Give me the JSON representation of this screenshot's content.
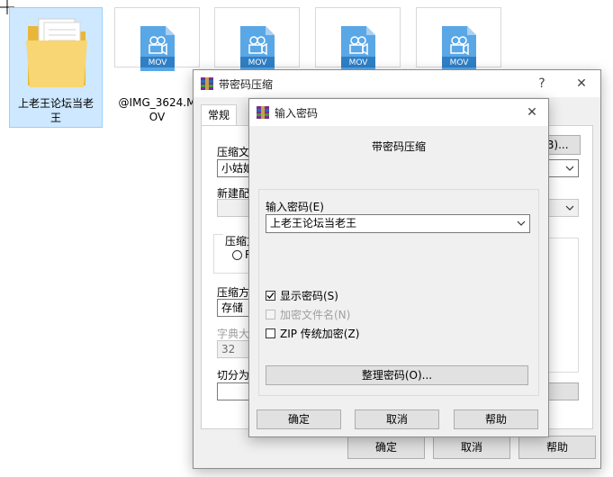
{
  "files": [
    {
      "label": "上老王论坛当老王",
      "type": "folder"
    },
    {
      "label": "@IMG_3624.MOV",
      "badge": "MOV",
      "type": "video"
    },
    {
      "badge": "MOV",
      "type": "video"
    },
    {
      "badge": "MOV",
      "type": "video"
    },
    {
      "badge": "MOV",
      "type": "video"
    }
  ],
  "back_dialog": {
    "title": "带密码压缩",
    "help_symbol": "?",
    "close_symbol": "✕",
    "tab_general": "常规",
    "label_archive": "压缩文",
    "archive_name": "小姑娘",
    "browse_label": "(B)...",
    "label_update": "新建配",
    "label_format": "压缩文",
    "radio_label": "R",
    "label_method": "压缩方",
    "method_value": "存储",
    "label_dict": "字典大",
    "dict_value": "32",
    "label_split": "切分为",
    "ok": "确定",
    "cancel": "取消",
    "help": "帮助"
  },
  "password_dialog": {
    "title": "输入密码",
    "close_symbol": "✕",
    "heading": "带密码压缩",
    "label_password": "输入密码(E)",
    "password_value": "上老王论坛当老王",
    "show_password": "显示密码(S)",
    "encrypt_names": "加密文件名(N)",
    "zip_legacy": "ZIP 传统加密(Z)",
    "organize": "整理密码(O)...",
    "ok": "确定",
    "cancel": "取消",
    "help": "帮助"
  }
}
